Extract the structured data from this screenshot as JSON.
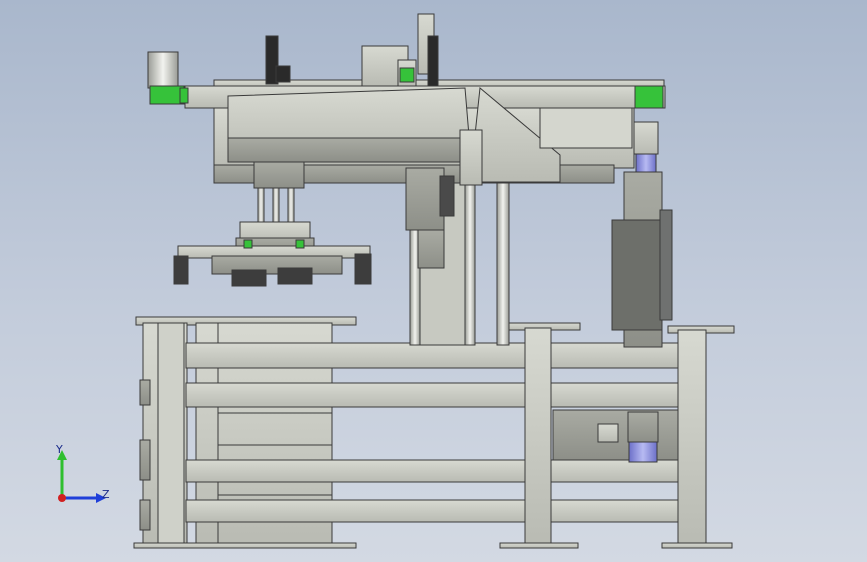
{
  "viewport": {
    "background_top": "#a9b7cc",
    "background_bottom": "#d3d9e3",
    "part_color": "#c9cbc3",
    "edge_color": "#3a3a3a",
    "accent_green": "#36c23a",
    "accent_blue": "#8a8fe0"
  },
  "triad": {
    "y_label": "Y",
    "z_label": "Z",
    "y_color": "#2fbf2f",
    "z_color": "#1f3fd9",
    "x_color": "#d12020"
  }
}
